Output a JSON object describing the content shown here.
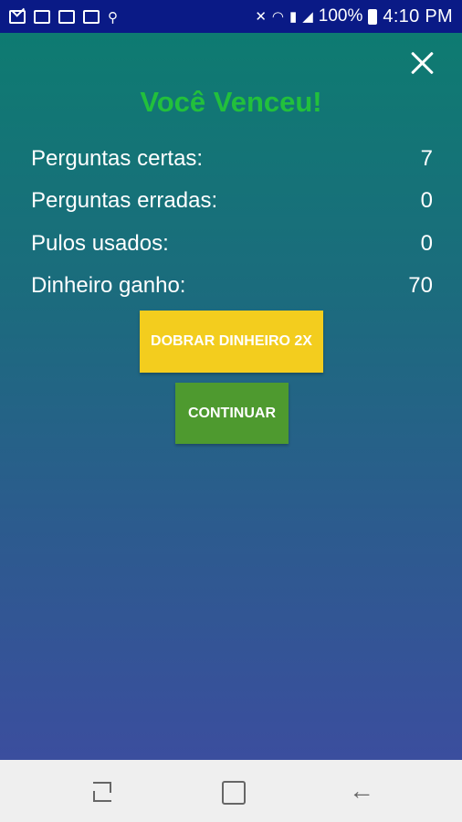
{
  "status_bar": {
    "battery_percent": "100%",
    "time": "4:10 PM",
    "icons": [
      "mail-icon",
      "gallery-icon",
      "gallery-icon",
      "image-icon",
      "usb-icon",
      "mute-icon",
      "wifi-icon",
      "sim-icon",
      "signal-icon",
      "battery-icon"
    ]
  },
  "dialog": {
    "title": "Você Venceu!",
    "close_icon": "close-icon",
    "stats": [
      {
        "label": "Perguntas certas:",
        "value": "7"
      },
      {
        "label": "Perguntas erradas:",
        "value": "0"
      },
      {
        "label": "Pulos usados:",
        "value": "0"
      },
      {
        "label": "Dinheiro ganho:",
        "value": "70"
      }
    ],
    "double_button_label": "DOBRAR DINHEIRO 2X",
    "continue_button_label": "CONTINUAR"
  },
  "colors": {
    "status_bar": "#0a1a86",
    "title": "#22c03c",
    "double_button": "#f3cd1e",
    "continue_button": "#4e9a2f",
    "gradient_top": "#0e7b71",
    "gradient_bottom": "#3b4e9e"
  },
  "nav_bar": {
    "recent_icon": "recent-apps-icon",
    "home_icon": "home-icon",
    "back_icon": "back-icon"
  }
}
